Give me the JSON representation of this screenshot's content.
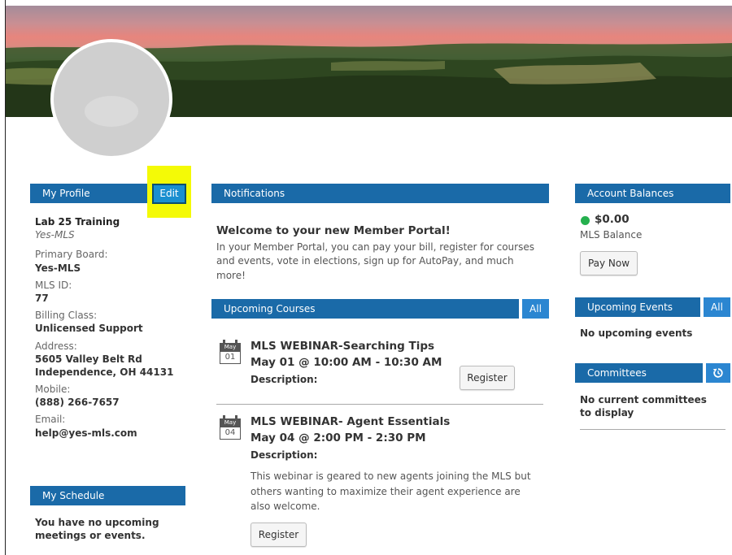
{
  "profile": {
    "header": "My Profile",
    "edit_label": "Edit",
    "name": "Lab 25 Training",
    "org": "Yes-MLS",
    "primary_board_label": "Primary Board:",
    "primary_board": "Yes-MLS",
    "mls_id_label": "MLS ID:",
    "mls_id": "77",
    "billing_class_label": "Billing Class:",
    "billing_class": "Unlicensed Support",
    "address_label": "Address:",
    "address_line1": "5605 Valley Belt Rd",
    "address_line2": "Independence, OH 44131",
    "mobile_label": "Mobile:",
    "mobile": "(888) 266-7657",
    "email_label": "Email:",
    "email": "help@yes-mls.com"
  },
  "schedule": {
    "header": "My Schedule",
    "empty_text": "You have no upcoming meetings or events."
  },
  "notifications": {
    "header": "Notifications",
    "welcome_title": "Welcome to your new Member Portal!",
    "welcome_body": "In your Member Portal, you can pay your bill, register for courses and events, vote in elections, sign up for AutoPay, and much more!"
  },
  "courses": {
    "header": "Upcoming Courses",
    "all_label": "All",
    "items": [
      {
        "month": "May",
        "day": "01",
        "title": "MLS WEBINAR-Searching Tips",
        "time": "May 01 @ 10:00 AM - 10:30 AM",
        "description_label": "Description:",
        "description": "",
        "register_label": "Register"
      },
      {
        "month": "May",
        "day": "04",
        "title": "MLS WEBINAR- Agent Essentials",
        "time": "May 04 @ 2:00 PM - 2:30 PM",
        "description_label": "Description:",
        "description": "This webinar is geared to new agents joining the MLS but others wanting to maximize their agent experience are also welcome.",
        "register_label": "Register"
      }
    ]
  },
  "balances": {
    "header": "Account Balances",
    "amount": "$0.00",
    "label": "MLS Balance",
    "pay_label": "Pay Now",
    "status_color": "#25b04e"
  },
  "events": {
    "header": "Upcoming Events",
    "all_label": "All",
    "empty_text": "No upcoming events"
  },
  "committees": {
    "header": "Committees",
    "icon": "refresh-icon",
    "empty_text": "No current committees to display"
  },
  "colors": {
    "header_bar": "#1a6aa8",
    "header_button": "#2b86d1",
    "highlight": "#f4fa06"
  }
}
